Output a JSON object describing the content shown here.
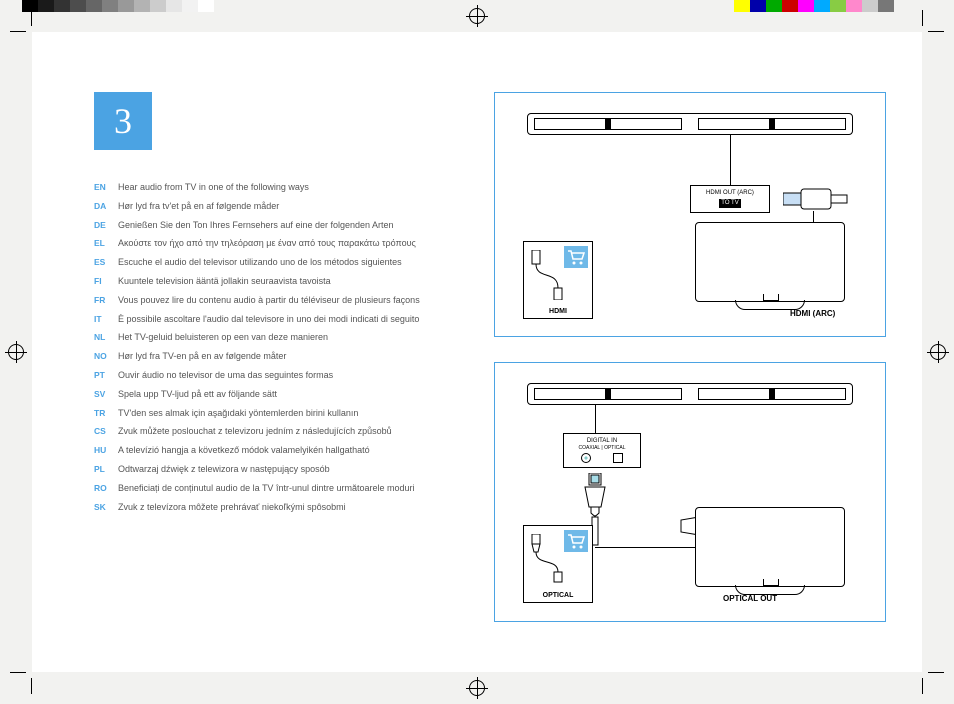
{
  "step_number": "3",
  "languages": [
    {
      "code": "EN",
      "text": "Hear audio from TV in one of the following ways"
    },
    {
      "code": "DA",
      "text": "Hør lyd fra tv'et på en af følgende måder"
    },
    {
      "code": "DE",
      "text": "Genießen Sie den Ton Ihres Fernsehers auf eine der folgenden Arten"
    },
    {
      "code": "EL",
      "text": "Ακούστε τον ήχο από την τηλεόραση με έναν από τους παρακάτω τρόπους"
    },
    {
      "code": "ES",
      "text": "Escuche el audio del televisor utilizando uno de los métodos siguientes"
    },
    {
      "code": "FI",
      "text": "Kuuntele television ääntä jollakin seuraavista tavoista"
    },
    {
      "code": "FR",
      "text": "Vous pouvez lire du contenu audio à partir du téléviseur de plusieurs façons"
    },
    {
      "code": "IT",
      "text": "È possibile ascoltare l'audio dal televisore in uno dei modi indicati di seguito"
    },
    {
      "code": "NL",
      "text": "Het TV-geluid beluisteren op een van deze manieren"
    },
    {
      "code": "NO",
      "text": "Hør lyd fra TV-en på en av følgende måter"
    },
    {
      "code": "PT",
      "text": "Ouvir áudio no televisor de uma das seguintes formas"
    },
    {
      "code": "SV",
      "text": "Spela upp TV-ljud på ett av följande sätt"
    },
    {
      "code": "TR",
      "text": "TV'den ses almak için aşağıdaki yöntemlerden birini kullanın"
    },
    {
      "code": "CS",
      "text": "Zvuk můžete poslouchat z televizoru jedním z následujících způsobů"
    },
    {
      "code": "HU",
      "text": "A televízió hangja a következő módok valamelyikén hallgatható"
    },
    {
      "code": "PL",
      "text": "Odtwarzaj dźwięk z telewizora w następujący sposób"
    },
    {
      "code": "RO",
      "text": "Beneficiați de conținutul audio de la TV într-unul dintre următoarele moduri"
    },
    {
      "code": "SK",
      "text": "Zvuk z televízora môžete prehrávať niekoľkými spôsobmi"
    }
  ],
  "diagram1": {
    "cable_label": "HDMI",
    "port_label_line1": "HDMI OUT (ARC)",
    "port_label_line2": "TO TV",
    "tv_label": "HDMI (ARC)"
  },
  "diagram2": {
    "cable_label": "OPTICAL",
    "port_label_line1": "DIGITAL IN",
    "port_label_line2": "COAXIAL | OPTICAL",
    "tv_label": "OPTICAL OUT"
  },
  "colorbar_left": [
    "#000000",
    "#1a1a1a",
    "#333333",
    "#4d4d4d",
    "#666666",
    "#808080",
    "#999999",
    "#b3b3b3",
    "#cccccc",
    "#e6e6e6",
    "#f2f2f2",
    "#ffffff"
  ],
  "colorbar_right": [
    "#ffff00",
    "#0000aa",
    "#00aa00",
    "#cc0000",
    "#ff00ff",
    "#00aaff",
    "#88cc44",
    "#ff88cc",
    "#cccccc",
    "#777777"
  ]
}
